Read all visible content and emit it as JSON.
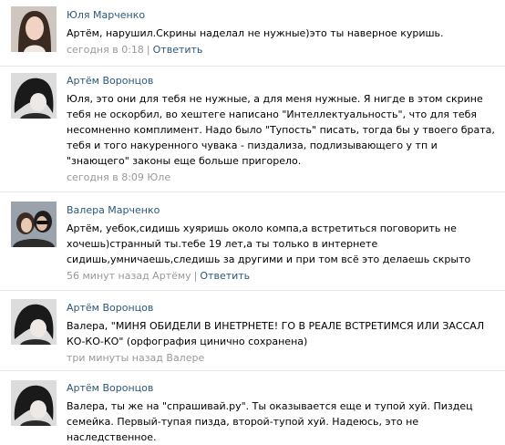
{
  "comments": [
    {
      "author": "Юля Марченко",
      "text": "Артём, нарушил.Скрины наделал не нужные)это ты наверное куришь.",
      "time": "сегодня в 0:18",
      "separator": "|",
      "reply_label": "Ответить",
      "avatar_icon": "female-portrait"
    },
    {
      "author": "Артём Воронцов",
      "text": "Юля, это они для тебя не нужные, а для меня нужные. Я нигде в этом скрине тебя не оскорбил, во хештеге написано \"Интеллектуальность\", что для тебя несомненно комплимент. Надо было \"Тупость\" писать, тогда бы у твоего брата, тебя и того накуренного чувака - пиздализа, подлизывающего у тп и \"знающего\" законы еще больше пригорело.",
      "time": "сегодня в 8:09 Юле",
      "avatar_icon": "dark-hair-portrait"
    },
    {
      "author": "Валера Марченко",
      "text": "Артём, уебок,сидишь хуяришь около компа,а встретиться поговорить не хочешь)странный ты.тебе 19 лет,а ты только в интернете сидишь,умничаешь,следишь за другими и при том всё это делаешь скрыто",
      "time": "56 минут назад Артёму",
      "separator": "|",
      "reply_label": "Ответить",
      "avatar_icon": "couple-portrait"
    },
    {
      "author": "Артём Воронцов",
      "text": "Валера, \"МИНЯ ОБИДЕЛИ В ИНЕТРНЕТЕ! ГО В РЕАЛЕ ВСТРЕТИМСЯ ИЛИ ЗАССАЛ КО-КО-КО\" (орфография цинично сохранена)",
      "time": "три минуты назад Валере",
      "avatar_icon": "dark-hair-portrait"
    },
    {
      "author": "Артём Воронцов",
      "text": "Валера, ты же на \"спрашивай.ру\". Ты оказывается еще и тупой хуй. Пиздец семейка. Первый-тупая пизда, второй-тупой хуй. Надеюсь, это не наследственное.",
      "avatar_icon": "dark-hair-portrait"
    }
  ]
}
